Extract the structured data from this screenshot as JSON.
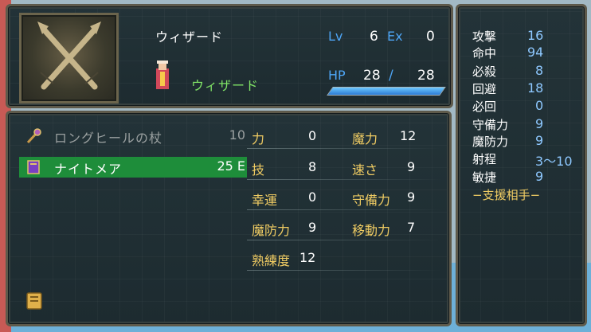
{
  "unit": {
    "name": "ウィザード",
    "class_name": "ウィザード",
    "lv_label": "Lv",
    "lv": "6",
    "ex_label": "Ex",
    "ex": "0",
    "hp_label": "HP",
    "hp_current": "28",
    "hp_slash": "/",
    "hp_max": "28",
    "hp_fraction": 1.0
  },
  "items": [
    {
      "name": "ロングヒールの杖",
      "uses": "10",
      "icon": "staff-icon",
      "selected": false
    },
    {
      "name": "ナイトメア",
      "uses": "25 E",
      "icon": "tome-icon",
      "selected": true
    }
  ],
  "stats": [
    {
      "label": "力",
      "value": "0"
    },
    {
      "label": "魔力",
      "value": "12"
    },
    {
      "label": "技",
      "value": "8"
    },
    {
      "label": "速さ",
      "value": "9"
    },
    {
      "label": "幸運",
      "value": "0"
    },
    {
      "label": "守備力",
      "value": "9"
    },
    {
      "label": "魔防力",
      "value": "9"
    },
    {
      "label": "移動力",
      "value": "7"
    },
    {
      "label": "熟練度",
      "value": "12"
    }
  ],
  "combat": [
    {
      "label": "攻撃",
      "value": "16"
    },
    {
      "label": "命中",
      "value": "94"
    },
    {
      "label": "必殺",
      "value": "8"
    },
    {
      "label": "回避",
      "value": "18"
    },
    {
      "label": "必回",
      "value": "0"
    },
    {
      "label": "守備力",
      "value": "9"
    },
    {
      "label": "魔防力",
      "value": "9"
    },
    {
      "label": "射程",
      "value": "3〜10"
    },
    {
      "label": "敏捷",
      "value": "9"
    }
  ],
  "support_title": "−支援相手−",
  "colors": {
    "panel_bg": "#1f2e33",
    "gold": "#f0cc63",
    "blue": "#4ea5f5",
    "green_highlight": "#1e8d3a",
    "class_green": "#7fe266"
  }
}
